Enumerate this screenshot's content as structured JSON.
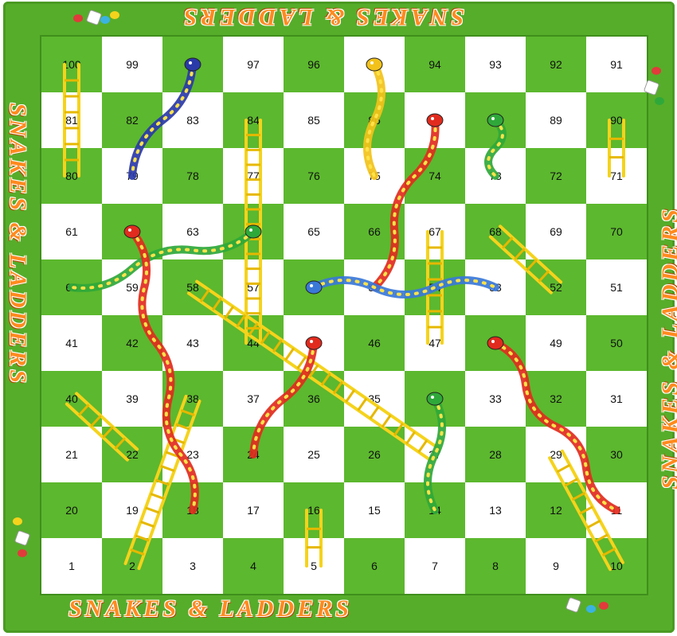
{
  "game": {
    "title_top": "SNAKES & LADDERS",
    "title_bottom": "SNAKES & LADDERS",
    "title_left": "SNAKES & LADDERS",
    "title_right": "SNAKES & LADDERS"
  },
  "board": {
    "rows": 10,
    "cols": 10,
    "start": "1",
    "finish": "100",
    "colors": {
      "green": "#5cb82e",
      "white": "#ffffff",
      "frame": "#56ad2a",
      "title": "#ff8a1f"
    }
  },
  "snakes": [
    {
      "head": 98,
      "tail": 79,
      "color": "#2a3aa8"
    },
    {
      "head": 95,
      "tail": 75,
      "color": "#f2c21a"
    },
    {
      "head": 87,
      "tail": 55,
      "color": "#e12b1e"
    },
    {
      "head": 88,
      "tail": 73,
      "color": "#2fa83a"
    },
    {
      "head": 64,
      "tail": 60,
      "color": "#2fa83a"
    },
    {
      "head": 62,
      "tail": 18,
      "color": "#e12b1e"
    },
    {
      "head": 56,
      "tail": 53,
      "color": "#3a78d8"
    },
    {
      "head": 48,
      "tail": 11,
      "color": "#e12b1e"
    },
    {
      "head": 45,
      "tail": 24,
      "color": "#e12b1e"
    },
    {
      "head": 34,
      "tail": 14,
      "color": "#2fa83a"
    }
  ],
  "ladders": [
    {
      "from": 80,
      "to": 100
    },
    {
      "from": 71,
      "to": 90
    },
    {
      "from": 44,
      "to": 84
    },
    {
      "from": 47,
      "to": 67
    },
    {
      "from": 52,
      "to": 68
    },
    {
      "from": 27,
      "to": 58
    },
    {
      "from": 22,
      "to": 40
    },
    {
      "from": 2,
      "to": 38
    },
    {
      "from": 5,
      "to": 16
    },
    {
      "from": 10,
      "to": 29
    }
  ]
}
